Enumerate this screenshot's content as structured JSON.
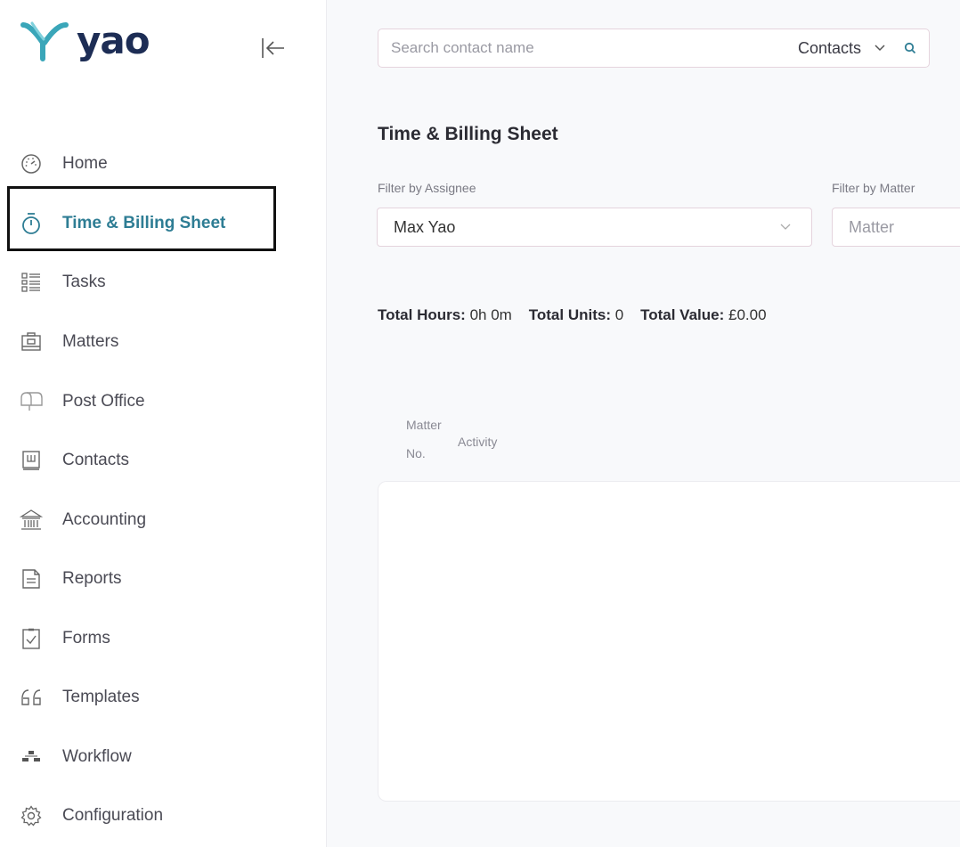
{
  "app": {
    "logo_text": "yao"
  },
  "sidebar": {
    "items": [
      {
        "label": "Home",
        "icon": "dashboard-gauge-icon"
      },
      {
        "label": "Time & Billing Sheet",
        "icon": "stopwatch-icon",
        "active": true
      },
      {
        "label": "Tasks",
        "icon": "task-list-icon"
      },
      {
        "label": "Matters",
        "icon": "briefcase-icon"
      },
      {
        "label": "Post Office",
        "icon": "mailbox-icon"
      },
      {
        "label": "Contacts",
        "icon": "contact-book-icon"
      },
      {
        "label": "Accounting",
        "icon": "bank-icon"
      },
      {
        "label": "Reports",
        "icon": "report-document-icon"
      },
      {
        "label": "Forms",
        "icon": "clipboard-check-icon"
      },
      {
        "label": "Templates",
        "icon": "quote-icon"
      },
      {
        "label": "Workflow",
        "icon": "workflow-icon"
      },
      {
        "label": "Configuration",
        "icon": "gear-icon"
      }
    ]
  },
  "search": {
    "placeholder": "Search contact name",
    "scope": "Contacts"
  },
  "page": {
    "title": "Time & Billing Sheet",
    "filters": {
      "assignee_label": "Filter by Assignee",
      "assignee_value": "Max Yao",
      "matter_label": "Filter by Matter",
      "matter_placeholder": "Matter"
    },
    "totals": {
      "hours_label": "Total Hours:",
      "hours_value": "0h 0m",
      "units_label": "Total Units:",
      "units_value": "0",
      "value_label": "Total Value:",
      "value_value": "£0.00"
    },
    "table": {
      "columns": [
        "Matter No.",
        "Activity"
      ],
      "col_matter_line1": "Matter",
      "col_matter_line2": "No.",
      "col_activity": "Activity"
    }
  },
  "colors": {
    "accent": "#2e7d94",
    "logo_teal": "#3aa6b9",
    "logo_navy": "#1d2d55",
    "highlight_border": "#111111"
  }
}
